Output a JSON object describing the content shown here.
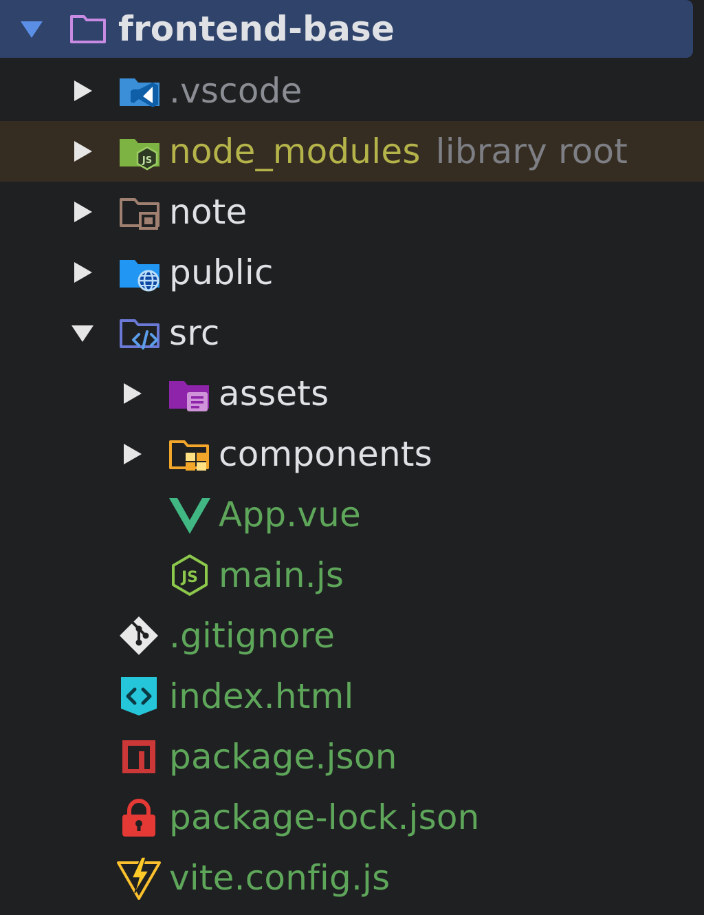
{
  "project_tree": {
    "root": {
      "label": "frontend-base",
      "expanded": true,
      "icon": "folder-outline-icon"
    },
    "rows": [
      {
        "label": ".vscode",
        "extra": "",
        "expanded": false,
        "icon": "vscode-folder-icon"
      },
      {
        "label": "node_modules",
        "extra": "library root",
        "expanded": false,
        "icon": "nodejs-folder-icon"
      },
      {
        "label": "note",
        "extra": "",
        "expanded": false,
        "icon": "excluded-folder-icon"
      },
      {
        "label": "public",
        "extra": "",
        "expanded": false,
        "icon": "globe-folder-icon"
      },
      {
        "label": "src",
        "extra": "",
        "expanded": true,
        "icon": "source-folder-icon"
      },
      {
        "label": "assets",
        "extra": "",
        "expanded": false,
        "icon": "assets-folder-icon"
      },
      {
        "label": "components",
        "extra": "",
        "expanded": false,
        "icon": "components-folder-icon"
      },
      {
        "label": "App.vue",
        "extra": "",
        "icon": "vue-icon"
      },
      {
        "label": "main.js",
        "extra": "",
        "icon": "nodejs-icon"
      },
      {
        "label": ".gitignore",
        "extra": "",
        "icon": "git-icon"
      },
      {
        "label": "index.html",
        "extra": "",
        "icon": "html-icon"
      },
      {
        "label": "package.json",
        "extra": "",
        "icon": "npm-icon"
      },
      {
        "label": "package-lock.json",
        "extra": "",
        "icon": "lock-icon"
      },
      {
        "label": "vite.config.js",
        "extra": "",
        "icon": "vite-icon"
      }
    ]
  },
  "colors": {
    "background": "#1f2022",
    "root_selection": "#2f436b",
    "library_root_highlight": "#362d22",
    "file_green": "#5ea65a",
    "library_olive": "#b5b44a"
  }
}
